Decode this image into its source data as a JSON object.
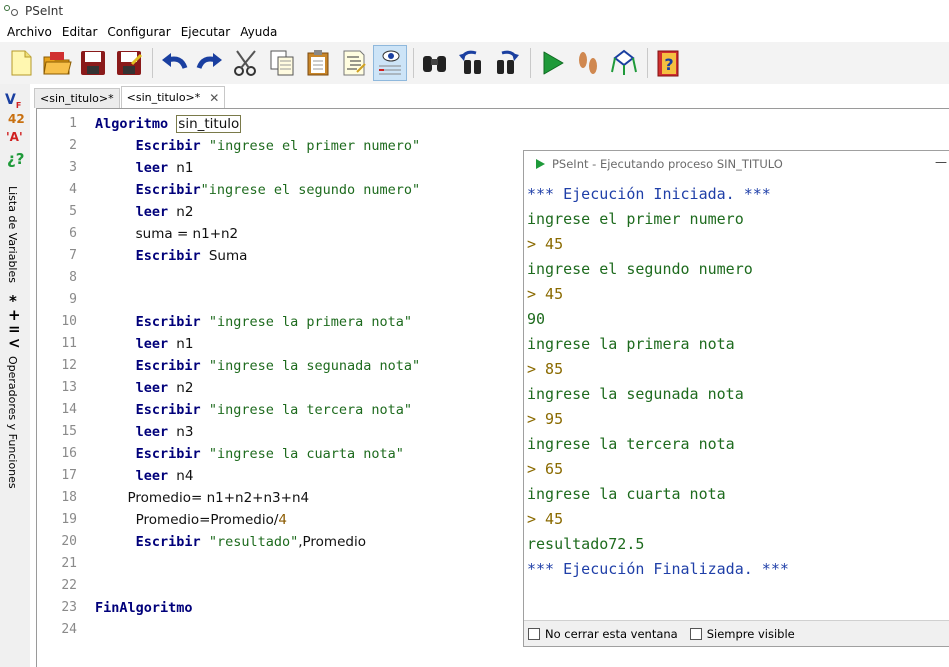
{
  "window": {
    "title": "PSeInt"
  },
  "menu": [
    "Archivo",
    "Editar",
    "Configurar",
    "Ejecutar",
    "Ayuda"
  ],
  "toolbar": {
    "buttons": [
      "new-file-icon",
      "open-folder-icon",
      "save-icon",
      "save-as-icon",
      "undo-icon",
      "redo-icon",
      "cut-icon",
      "copy-icon",
      "paste-icon",
      "correct-indent-icon",
      "step-by-step-icon",
      "find-icon",
      "find-previous-icon",
      "find-next-icon",
      "run-icon",
      "step-icon",
      "flowchart-icon",
      "help-icon"
    ]
  },
  "sidebar": {
    "variables_label": "Lista de Variables",
    "operators_label": "Operadores y Funciones",
    "glyph1": "V",
    "glyph1_sub": "F",
    "glyph2": "42",
    "glyph3": "'A'",
    "glyph4": "¿?",
    "glyph5": "*",
    "glyph6": "+",
    "glyph7": "=",
    "glyph8": "<"
  },
  "tabs": [
    {
      "label": "<sin_titulo>*"
    },
    {
      "label": "<sin_titulo>*",
      "close": "✕"
    }
  ],
  "editor": {
    "line_numbers": [
      "1",
      "2",
      "3",
      "4",
      "5",
      "6",
      "7",
      "8",
      "9",
      "10",
      "11",
      "12",
      "13",
      "14",
      "15",
      "16",
      "17",
      "18",
      "19",
      "20",
      "21",
      "22",
      "23",
      "24"
    ],
    "l1_kw": "Algoritmo",
    "l1_name": "sin_titulo",
    "l2_kw": "Escribir",
    "l2_str": "\"ingrese el primer numero\"",
    "l3_kw": "leer",
    "l3_rest": "n1",
    "l4_kw": "Escribir",
    "l4_str": "\"ingrese el segundo numero\"",
    "l5_kw": "leer",
    "l5_rest": "n2",
    "l6_rest": "suma = n1+n2",
    "l7_kw": "Escribir",
    "l7_rest": "Suma",
    "l10_kw": "Escribir",
    "l10_str": "\"ingrese la primera nota\"",
    "l11_kw": "leer",
    "l11_rest": "n1",
    "l12_kw": "Escribir",
    "l12_str": "\"ingrese la segunada nota\"",
    "l13_kw": "leer",
    "l13_rest": "n2",
    "l14_kw": "Escribir",
    "l14_str": "\"ingrese la tercera nota\"",
    "l15_kw": "leer",
    "l15_rest": "n3",
    "l16_kw": "Escribir",
    "l16_str": "\"ingrese la cuarta nota\"",
    "l17_kw": "leer",
    "l17_rest": "n4",
    "l18_rest": "Promedio= n1+n2+n3+n4",
    "l19_rest": "Promedio=Promedio/",
    "l19_num": "4",
    "l20_kw": "Escribir",
    "l20_str": "\"resultado\"",
    "l20_rest": ",Promedio",
    "l23_kw": "FinAlgoritmo"
  },
  "execution": {
    "title": "PSeInt - Ejecutando proceso SIN_TITULO",
    "minimize": "—",
    "output": [
      {
        "text": "*** Ejecución Iniciada. ***",
        "style": "blue"
      },
      {
        "text": "ingrese el primer numero",
        "style": "green"
      },
      {
        "text": "> 45",
        "style": "olive"
      },
      {
        "text": "ingrese el segundo numero",
        "style": "green"
      },
      {
        "text": "> 45",
        "style": "olive"
      },
      {
        "text": "90",
        "style": "green"
      },
      {
        "text": "ingrese la primera nota",
        "style": "green"
      },
      {
        "text": "> 85",
        "style": "olive"
      },
      {
        "text": "ingrese la segunada nota",
        "style": "green"
      },
      {
        "text": "> 95",
        "style": "olive"
      },
      {
        "text": "ingrese la tercera nota",
        "style": "green"
      },
      {
        "text": "> 65",
        "style": "olive"
      },
      {
        "text": "ingrese la cuarta nota",
        "style": "green"
      },
      {
        "text": "> 45",
        "style": "olive"
      },
      {
        "text": "resultado72.5",
        "style": "green"
      },
      {
        "text": "*** Ejecución Finalizada. ***",
        "style": "blue"
      }
    ],
    "no_close_label": "No cerrar esta ventana",
    "always_visible_label": "Siempre visible"
  }
}
